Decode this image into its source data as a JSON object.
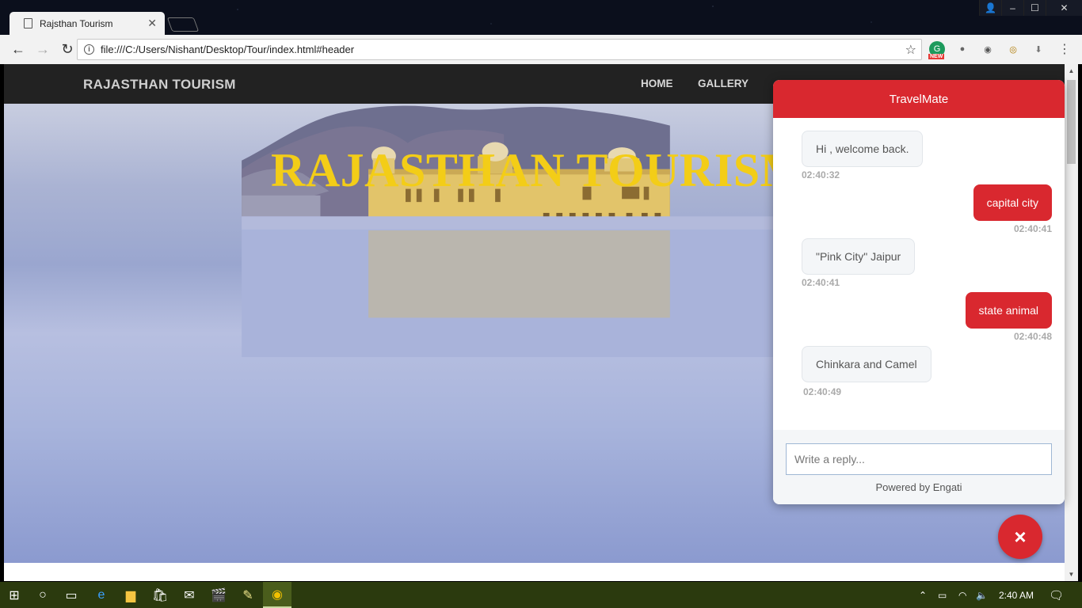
{
  "browser": {
    "tab_title": "Rajsthan Tourism",
    "url": "file:///C:/Users/Nishant/Desktop/Tour/index.html#header",
    "extension_badge": "NEW"
  },
  "site": {
    "brand": "RAJASTHAN TOURISM",
    "nav": [
      "HOME",
      "GALLERY"
    ],
    "hero_title": "RAJASTHAN TOURISM"
  },
  "chat": {
    "title": "TravelMate",
    "messages": [
      {
        "from": "bot",
        "text": "Hi , welcome back.",
        "time": "02:40:32"
      },
      {
        "from": "user",
        "text": "capital city",
        "time": "02:40:41"
      },
      {
        "from": "bot",
        "text": "\"Pink City\" Jaipur",
        "time": "02:40:41"
      },
      {
        "from": "user",
        "text": "state animal",
        "time": "02:40:48"
      },
      {
        "from": "bot",
        "text": "Chinkara and Camel",
        "time": "02:40:49"
      }
    ],
    "input_placeholder": "Write a reply...",
    "powered_by": "Powered by Engati",
    "close_label": "×"
  },
  "taskbar": {
    "clock": "2:40 AM"
  },
  "colors": {
    "accent": "#d9282f",
    "hero_title": "#f3cd17",
    "nav_bg": "#222222",
    "taskbar": "#2b3a0e"
  }
}
